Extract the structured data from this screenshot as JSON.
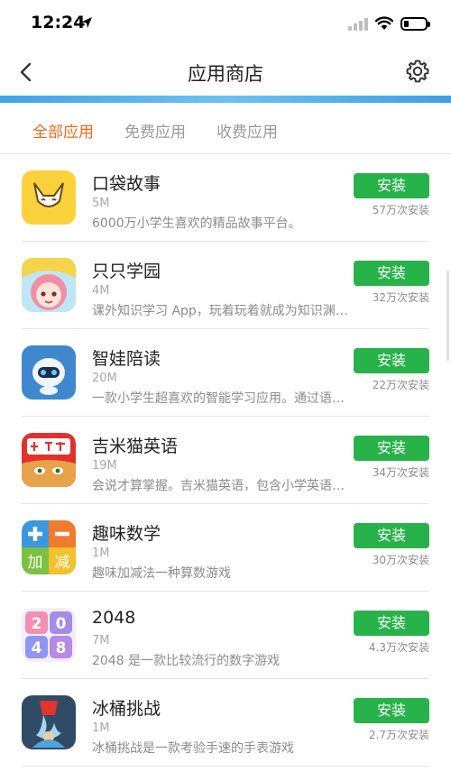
{
  "status_bar": {
    "time": "12:24"
  },
  "nav": {
    "title": "应用商店"
  },
  "tabs": [
    {
      "label": "全部应用",
      "active": true
    },
    {
      "label": "免费应用",
      "active": false
    },
    {
      "label": "收费应用",
      "active": false
    }
  ],
  "apps": [
    {
      "name": "口袋故事",
      "size": "5M",
      "desc": "6000万小学生喜欢的精品故事平台。",
      "button": "安装",
      "installs": "57万次安装",
      "icon": "fox-icon"
    },
    {
      "name": "只只学园",
      "size": "4M",
      "desc": "课外知识学习 App，玩着玩着就成为知识渊博的小...",
      "button": "安装",
      "installs": "32万次安装",
      "icon": "girl-icon"
    },
    {
      "name": "智娃陪读",
      "size": "20M",
      "desc": "一款小学生超喜欢的智能学习应用。通过语音互动...",
      "button": "安装",
      "installs": "22万次安装",
      "icon": "robot-icon"
    },
    {
      "name": "吉米猫英语",
      "size": "19M",
      "desc": "会说才算掌握。吉米猫英语，包含小学英语课本内...",
      "button": "安装",
      "installs": "34万次安装",
      "icon": "cat-icon"
    },
    {
      "name": "趣味数学",
      "size": "1M",
      "desc": "趣味加减法一种算数游戏",
      "button": "安装",
      "installs": "30万次安装",
      "icon": "math-icon",
      "icon_text": [
        "加",
        "减"
      ]
    },
    {
      "name": "2048",
      "size": "7M",
      "desc": "2048 是一款比较流行的数字游戏",
      "button": "安装",
      "installs": "4.3万次安装",
      "icon": "numbers-icon",
      "icon_text": [
        "2",
        "0",
        "4",
        "8"
      ]
    },
    {
      "name": "冰桶挑战",
      "size": "1M",
      "desc": "冰桶挑战是一款考验手速的手表游戏",
      "button": "安装",
      "installs": "2.7万次安装",
      "icon": "bucket-icon"
    }
  ],
  "colors": {
    "accent": "#f26a1a",
    "install_green": "#27b24a",
    "header_band": "#4aaee9"
  }
}
